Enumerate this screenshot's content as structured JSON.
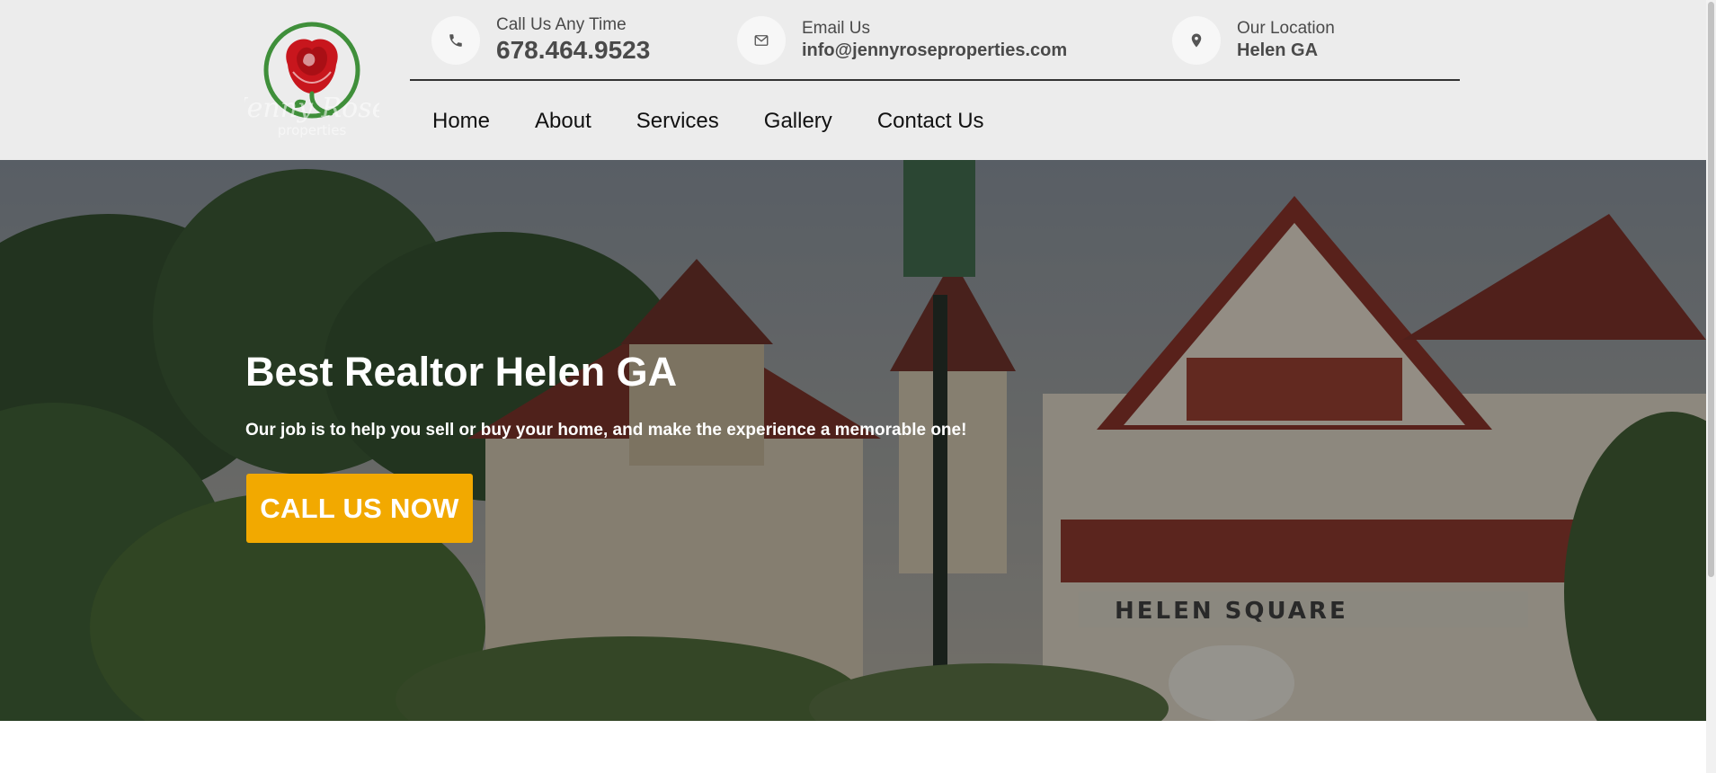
{
  "header": {
    "logo": {
      "alt": "Jenny Rose Properties",
      "brand_text": "Jenny Rose",
      "brand_sub": "properties"
    },
    "phone": {
      "label": "Call Us Any Time",
      "value": "678.464.9523",
      "icon": "phone-icon"
    },
    "email": {
      "label": "Email Us",
      "value": "info@jennyroseproperties.com",
      "icon": "envelope-icon"
    },
    "location": {
      "label": "Our Location",
      "value": "Helen GA",
      "icon": "map-pin-icon"
    }
  },
  "nav": {
    "items": [
      {
        "label": "Home"
      },
      {
        "label": "About"
      },
      {
        "label": "Services"
      },
      {
        "label": "Gallery"
      },
      {
        "label": "Contact Us"
      }
    ]
  },
  "hero": {
    "title": "Best Realtor Helen GA",
    "subtitle": "Our job is to help you sell or buy your home, and make the experience a memorable one!",
    "cta_label": "CALL US NOW",
    "sign_text": "HELEN SQUARE"
  },
  "colors": {
    "accent": "#f2a900",
    "header_bg": "#ececec",
    "text_dark": "#4a4a4a",
    "rose_red": "#c8161d",
    "rose_green": "#3f8f3a"
  }
}
